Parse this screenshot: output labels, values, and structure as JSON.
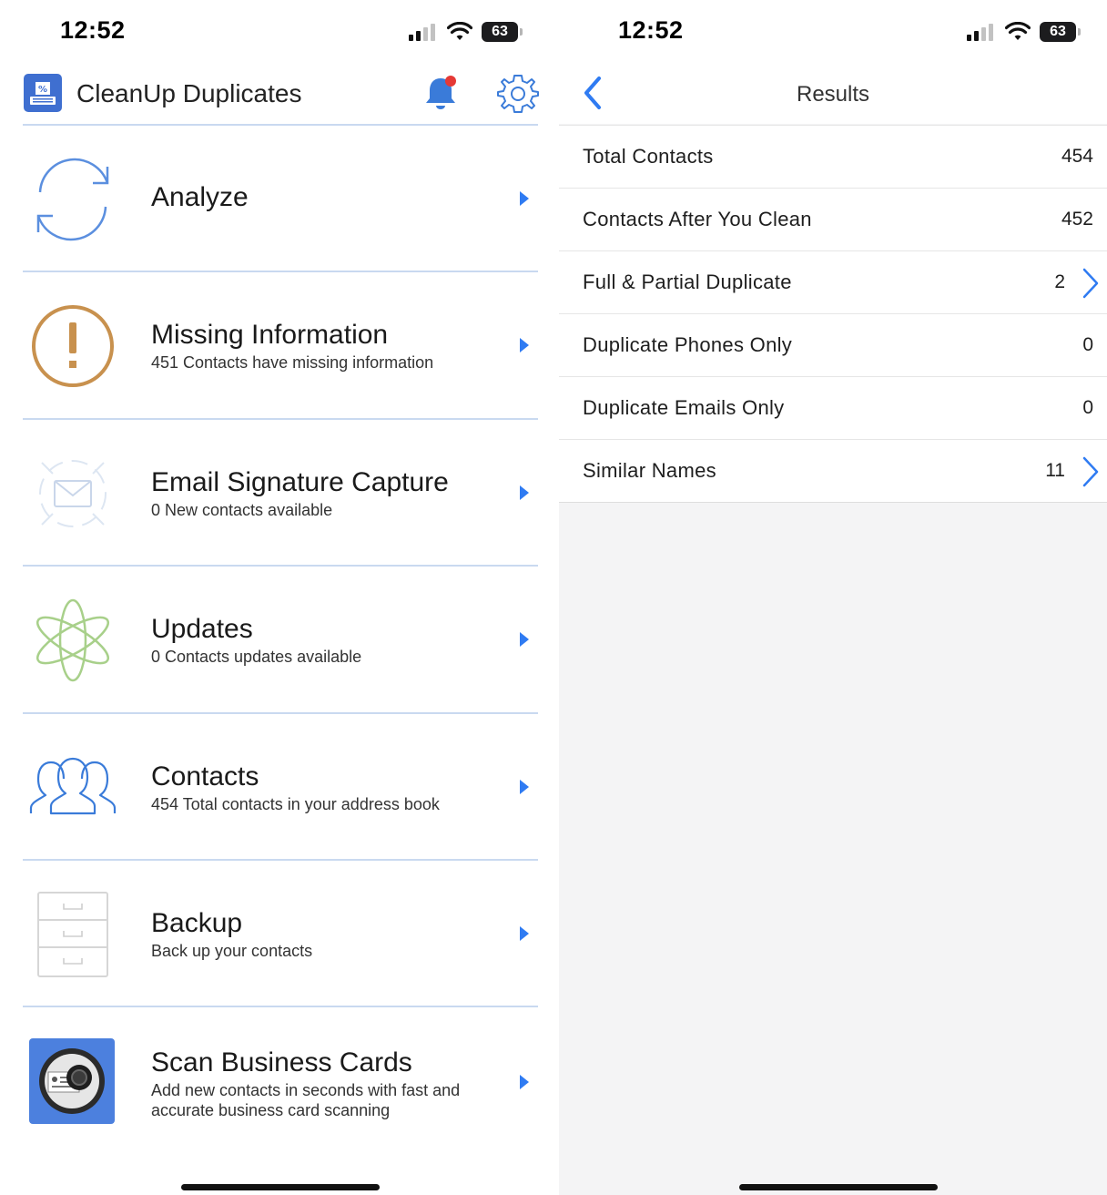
{
  "status_bar": {
    "time": "12:52",
    "battery": "63"
  },
  "home": {
    "app_title": "CleanUp Duplicates",
    "menu": [
      {
        "title": "Analyze",
        "subtitle": ""
      },
      {
        "title": "Missing Information",
        "subtitle": "451 Contacts have missing information"
      },
      {
        "title": "Email Signature Capture",
        "subtitle": "0 New contacts available"
      },
      {
        "title": "Updates",
        "subtitle": "0 Contacts updates available"
      },
      {
        "title": "Contacts",
        "subtitle": "454 Total contacts in your address book"
      },
      {
        "title": "Backup",
        "subtitle": "Back up your contacts"
      },
      {
        "title": "Scan Business Cards",
        "subtitle": "Add new contacts in seconds with fast and accurate business card scanning"
      }
    ]
  },
  "results": {
    "title": "Results",
    "rows": [
      {
        "label": "Total Contacts",
        "value": "454"
      },
      {
        "label": "Contacts After You Clean",
        "value": "452"
      },
      {
        "label": "Full & Partial Duplicate",
        "value": "2"
      },
      {
        "label": "Duplicate Phones Only",
        "value": "0"
      },
      {
        "label": "Duplicate Emails Only",
        "value": "0"
      },
      {
        "label": "Similar Names",
        "value": "11"
      }
    ]
  },
  "colors": {
    "accent_blue": "#2f7bf2",
    "logo_blue": "#3f6fd0",
    "warning_brown": "#c8914e",
    "updates_green": "#a8d08a",
    "notification_red": "#e53935"
  },
  "icons": {
    "analyze": "refresh-cycle-icon",
    "missing": "exclamation-circle-icon",
    "email": "envelope-target-icon",
    "updates": "atom-icon",
    "contacts": "people-group-icon",
    "backup": "file-cabinet-icon",
    "scan": "camera-card-icon"
  }
}
